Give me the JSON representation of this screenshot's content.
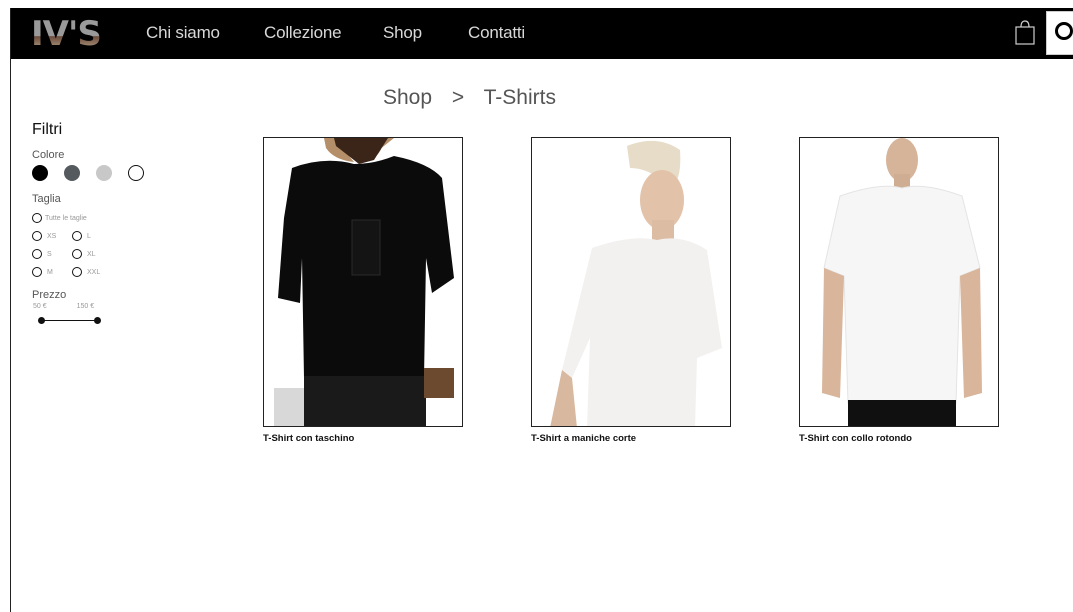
{
  "nav": {
    "logo": "IV'S",
    "links": [
      "Chi siamo",
      "Collezione",
      "Shop",
      "Contatti"
    ]
  },
  "breadcrumb": {
    "parent": "Shop",
    "separator": ">",
    "current": "T-Shirts"
  },
  "filters": {
    "title": "Filtri",
    "color_label": "Colore",
    "colors": [
      "#000000",
      "#555a5e",
      "#c8c8c8",
      "#ffffff"
    ],
    "size_label": "Taglia",
    "all_sizes": "Tutte le taglie",
    "sizes": [
      [
        "XS",
        "L"
      ],
      [
        "S",
        "XL"
      ],
      [
        "M",
        "XXL"
      ]
    ],
    "price_label": "Prezzo",
    "price_min": "50 €",
    "price_max": "150 €"
  },
  "products": [
    {
      "name": "T-Shirt con taschino",
      "color": "#0b0b0b"
    },
    {
      "name": "T-Shirt a maniche corte",
      "color": "#f3f1ef"
    },
    {
      "name": "T-Shirt con collo rotondo",
      "color": "#f5f5f5"
    }
  ]
}
